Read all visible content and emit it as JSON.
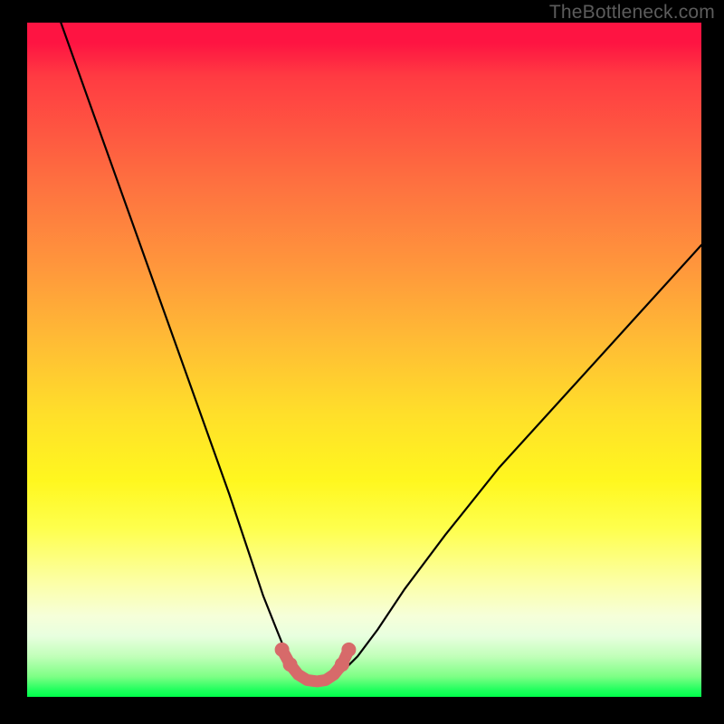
{
  "watermark": "TheBottleneck.com",
  "chart_data": {
    "type": "line",
    "title": "",
    "xlabel": "",
    "ylabel": "",
    "xlim": [
      0,
      100
    ],
    "ylim": [
      0,
      100
    ],
    "series": [
      {
        "name": "curve",
        "x": [
          5,
          10,
          15,
          20,
          25,
          30,
          33,
          35,
          37,
          38,
          39,
          40,
          41,
          42,
          43,
          44,
          45,
          46,
          47,
          49,
          52,
          56,
          62,
          70,
          80,
          90,
          100
        ],
        "y": [
          100,
          86,
          72,
          58,
          44,
          30,
          21,
          15,
          10,
          7.5,
          5.5,
          4,
          3,
          2.3,
          2,
          2,
          2.3,
          3,
          4,
          6,
          10,
          16,
          24,
          34,
          45,
          56,
          67
        ]
      },
      {
        "name": "highlight",
        "x": [
          37.8,
          39.0,
          40.2,
          41.5,
          43.0,
          44.3,
          45.5,
          46.7,
          47.7
        ],
        "y": [
          7.0,
          4.8,
          3.3,
          2.5,
          2.3,
          2.5,
          3.3,
          4.8,
          7.0
        ]
      }
    ],
    "colors": {
      "curve_stroke": "#000000",
      "highlight_stroke": "#d76a6a",
      "highlight_fill": "#d76a6a"
    }
  }
}
